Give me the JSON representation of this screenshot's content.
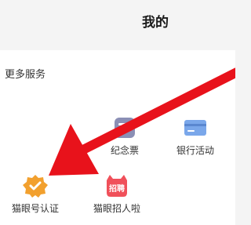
{
  "header": {
    "title": "我的"
  },
  "more_services": {
    "title": "更多服务",
    "items": [
      {
        "label": "纪念票",
        "icon": "ticket-icon"
      },
      {
        "label": "银行活动",
        "icon": "bank-card-icon"
      },
      {
        "label": "猫眼号认证",
        "icon": "verified-badge-icon"
      },
      {
        "label": "猫眼招人啦",
        "icon": "recruit-icon",
        "badge_text": "招聘"
      }
    ]
  },
  "colors": {
    "arrow": "#e8121b",
    "verified": "#f2a02e",
    "recruit": "#f0505a",
    "bank": "#7aa7ea",
    "ticket": "#8b8fb5"
  }
}
